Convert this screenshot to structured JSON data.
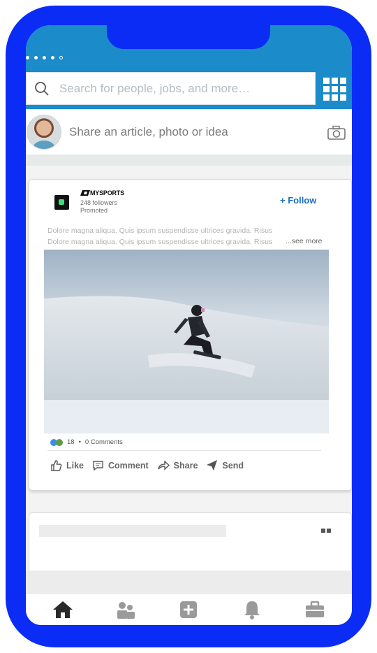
{
  "search": {
    "placeholder": "Search for people, jobs, and more…"
  },
  "share": {
    "prompt": "Share an article, photo or idea"
  },
  "post": {
    "brand": "MYSPORTS",
    "followers": "248 followers",
    "promoted": "Promoted",
    "follow_label": "+ Follow",
    "text_line1": "Dolore magna aliqua. Quis ipsum suspendisse ultrices gravida. Risus",
    "text_line2": "Dolore magna aliqua. Quis ipsum suspendisse ultrices gravida. Risus",
    "see_more": "...see more",
    "reaction_count": "18",
    "separator": "•",
    "comments": "0 Comments",
    "actions": {
      "like": "Like",
      "comment": "Comment",
      "share": "Share",
      "send": "Send"
    }
  },
  "colors": {
    "frame": "#0a2cf5",
    "header": "#1b8bc9",
    "link": "#1c6fc0"
  },
  "icons": {
    "status": "signal-dots",
    "search": "search-icon",
    "apps": "grid-icon",
    "camera": "camera-icon",
    "nav": [
      "home-icon",
      "people-icon",
      "post-icon",
      "bell-icon",
      "briefcase-icon"
    ]
  }
}
